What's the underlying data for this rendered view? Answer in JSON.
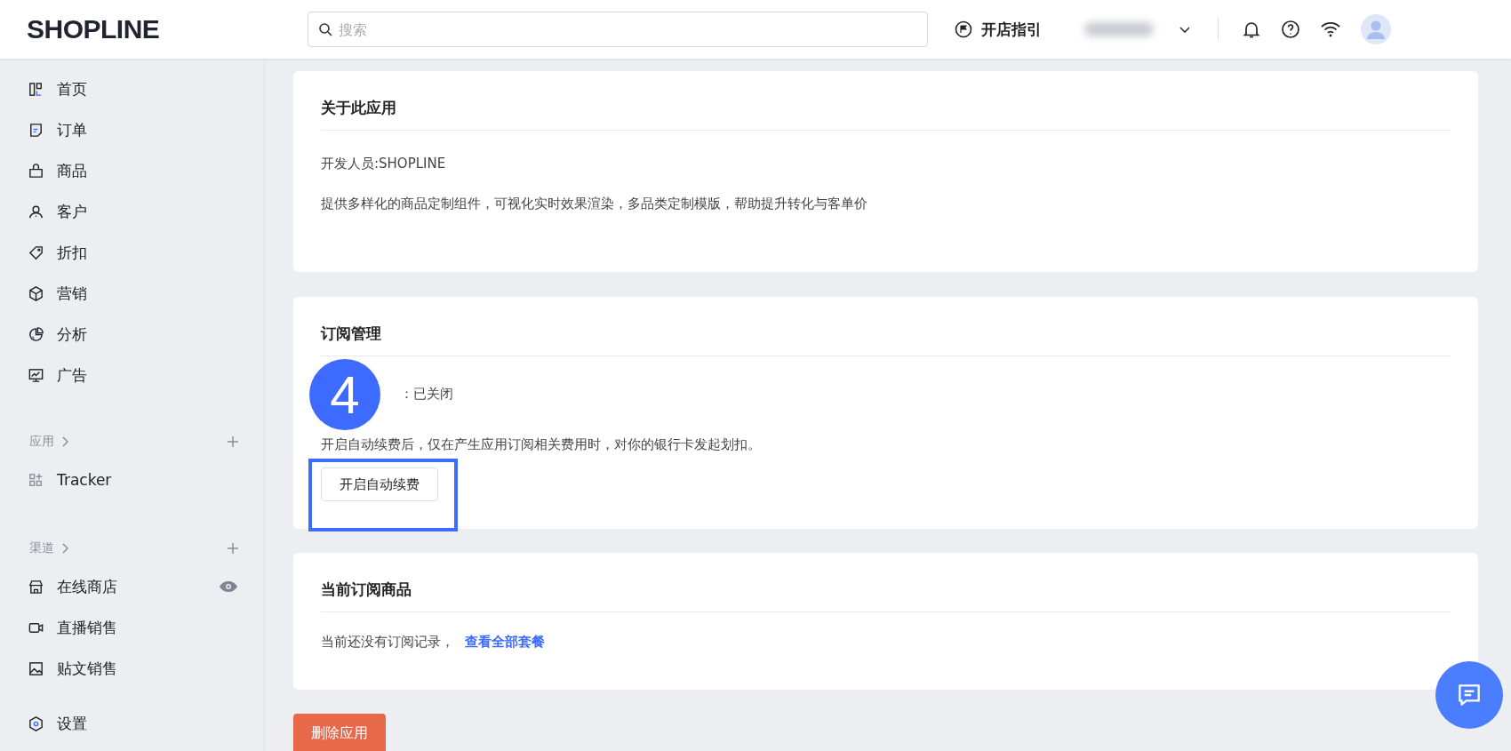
{
  "header": {
    "logo": "SHOPLINE",
    "search": {
      "placeholder": "搜索"
    },
    "guide": "开店指引"
  },
  "sidebar": {
    "main": [
      {
        "label": "首页"
      },
      {
        "label": "订单"
      },
      {
        "label": "商品"
      },
      {
        "label": "客户"
      },
      {
        "label": "折扣"
      },
      {
        "label": "营销"
      },
      {
        "label": "分析"
      },
      {
        "label": "广告"
      }
    ],
    "apps": {
      "title": "应用",
      "items": [
        {
          "label": "Tracker"
        }
      ]
    },
    "channels": {
      "title": "渠道",
      "items": [
        {
          "label": "在线商店"
        },
        {
          "label": "直播销售"
        },
        {
          "label": "贴文销售"
        }
      ]
    },
    "settings": "设置"
  },
  "about": {
    "title": "关于此应用",
    "developer": "开发人员:SHOPLINE",
    "description": "提供多样化的商品定制组件，可视化实时效果渲染，多品类定制模版，帮助提升转化与客单价"
  },
  "subscription": {
    "title": "订阅管理",
    "status": "：已关闭",
    "note": "开启自动续费后，仅在产生应用订阅相关费用时，对你的银行卡发起划扣。",
    "button": "开启自动续费",
    "step": "4"
  },
  "current": {
    "title": "当前订阅商品",
    "empty": "当前还没有订阅记录，",
    "link": "查看全部套餐"
  },
  "delete_button": "删除应用"
}
